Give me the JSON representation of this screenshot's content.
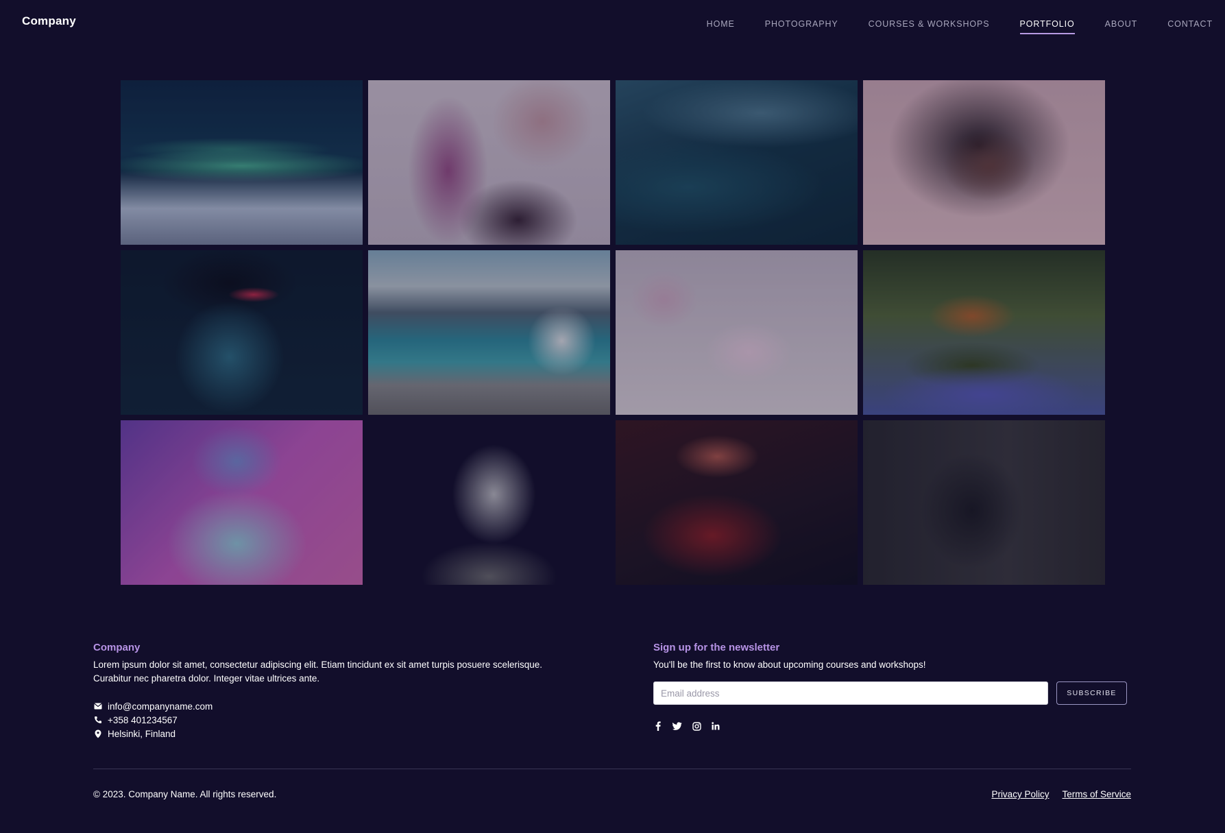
{
  "brand": {
    "name": "Company"
  },
  "nav": {
    "items": [
      {
        "label": "HOME",
        "active": false
      },
      {
        "label": "PHOTOGRAPHY",
        "active": false
      },
      {
        "label": "COURSES & WORKSHOPS",
        "active": false
      },
      {
        "label": "PORTFOLIO",
        "active": true
      },
      {
        "label": "ABOUT",
        "active": false
      },
      {
        "label": "CONTACT",
        "active": false
      }
    ]
  },
  "gallery": {
    "images": [
      {
        "subject": "aurora over icy landscape"
      },
      {
        "subject": "profile of woman with braid"
      },
      {
        "subject": "dark ocean wave"
      },
      {
        "subject": "woman with curly hair"
      },
      {
        "subject": "woman with sunglasses"
      },
      {
        "subject": "white dog by mountain lake"
      },
      {
        "subject": "pink flower"
      },
      {
        "subject": "dog in bluebell forest"
      },
      {
        "subject": "woman in neon light"
      },
      {
        "subject": "woman black and white portrait"
      },
      {
        "subject": "person in red coat"
      },
      {
        "subject": "man sitting on steps"
      }
    ]
  },
  "footer": {
    "company": {
      "heading": "Company",
      "description": "Lorem ipsum dolor sit amet, consectetur adipiscing elit. Etiam tincidunt ex sit amet turpis posuere scelerisque. Curabitur nec pharetra dolor. Integer vitae ultrices ante.",
      "email": "info@companyname.com",
      "phone": "+358 401234567",
      "location": "Helsinki, Finland"
    },
    "newsletter": {
      "heading": "Sign up for the newsletter",
      "text": "You'll be the first to know about upcoming courses and workshops!",
      "email_placeholder": "Email address",
      "email_value": "",
      "subscribe_label": "SUBSCRIBE"
    },
    "social": [
      "facebook-icon",
      "twitter-icon",
      "instagram-icon",
      "linkedin-icon"
    ],
    "copyright": "© 2023. Company Name. All rights reserved.",
    "links": {
      "privacy": "Privacy Policy",
      "terms": "Terms of Service"
    }
  },
  "colors": {
    "background": "#120e2b",
    "accent": "#b793e6",
    "text": "#ffffff"
  }
}
